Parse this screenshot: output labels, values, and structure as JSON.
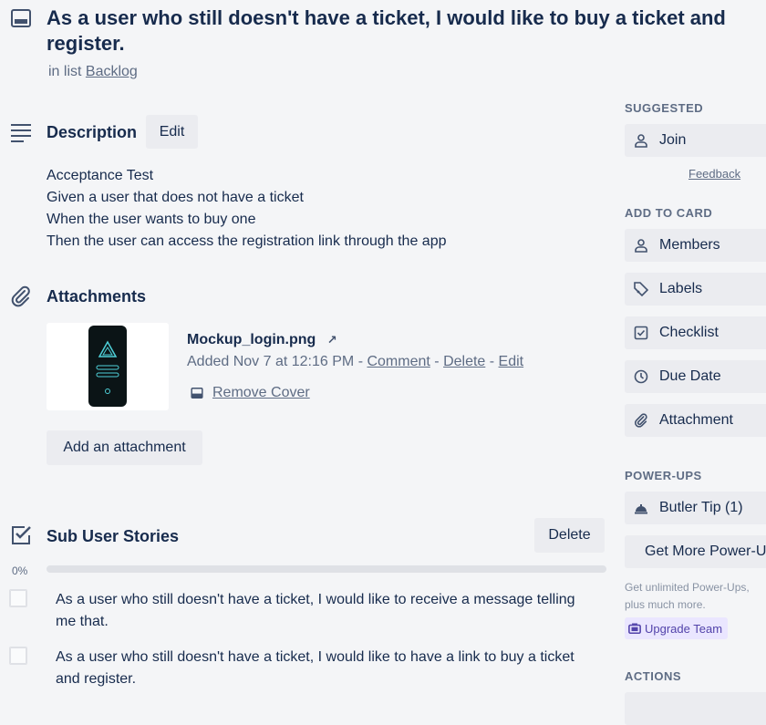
{
  "card": {
    "title": "As a user who still doesn't have a ticket, I would like to buy a ticket and register.",
    "in_list_prefix": "in list",
    "list_name": "Backlog"
  },
  "description": {
    "heading": "Description",
    "edit_label": "Edit",
    "lines": [
      "Acceptance Test",
      "Given a user that does not have a ticket",
      "When the user wants to buy one",
      "Then the user can access the registration link through the app"
    ]
  },
  "attachments": {
    "heading": "Attachments",
    "items": [
      {
        "name": "Mockup_login.png",
        "open_glyph": "↗",
        "added": "Added Nov 7 at 12:16 PM",
        "sep": "-",
        "comment": "Comment",
        "delete": "Delete",
        "edit": "Edit",
        "remove_cover": "Remove Cover"
      }
    ],
    "add_label": "Add an attachment"
  },
  "checklist": {
    "heading": "Sub User Stories",
    "delete_label": "Delete",
    "progress_label": "0%",
    "progress": 0,
    "items": [
      {
        "text": "As a user who still doesn't have a ticket, I would like to receive a message telling me that.",
        "checked": false
      },
      {
        "text": "As a user who still doesn't have a ticket, I would like to have a link to buy a ticket and register.",
        "checked": false
      }
    ]
  },
  "sidebar": {
    "suggested_heading": "SUGGESTED",
    "join_label": "Join",
    "feedback_label": "Feedback",
    "add_to_card_heading": "ADD TO CARD",
    "add_to_card": [
      {
        "label": "Members",
        "icon": "person-icon"
      },
      {
        "label": "Labels",
        "icon": "tag-icon"
      },
      {
        "label": "Checklist",
        "icon": "checklist-icon"
      },
      {
        "label": "Due Date",
        "icon": "clock-icon"
      },
      {
        "label": "Attachment",
        "icon": "paperclip-icon"
      }
    ],
    "powerups_heading": "POWER-UPS",
    "butler_label": "Butler Tip (1)",
    "get_more_label": "Get More Power-Ups",
    "powerups_note": "Get unlimited Power-Ups, plus much more.",
    "upgrade_label": "Upgrade Team",
    "actions_heading": "ACTIONS"
  },
  "colors": {
    "background": "#f4f5f7",
    "text": "#172b4d",
    "muted": "#5e6c84",
    "button": "#ebecf0",
    "upgrade_bg": "#eae6ff",
    "upgrade_text": "#5243aa"
  }
}
